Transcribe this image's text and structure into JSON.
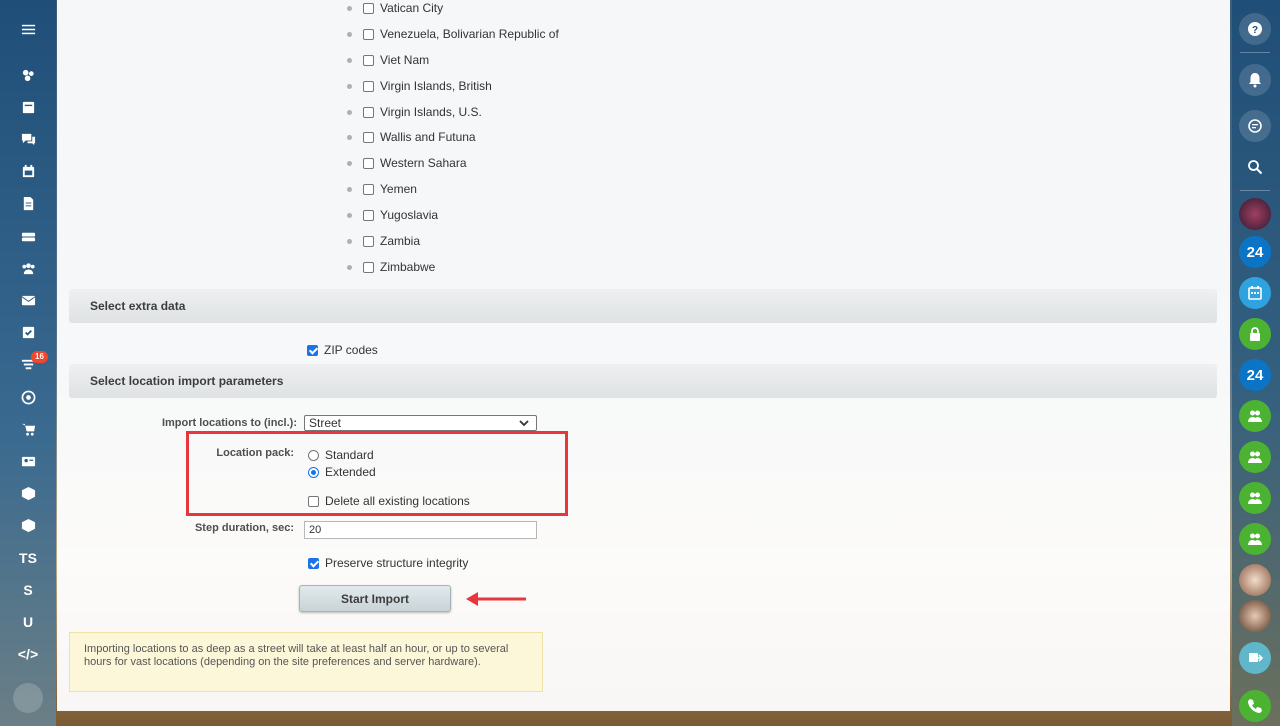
{
  "countries": [
    "Vatican City",
    "Venezuela, Bolivarian Republic of",
    "Viet Nam",
    "Virgin Islands, British",
    "Virgin Islands, U.S.",
    "Wallis and Futuna",
    "Western Sahara",
    "Yemen",
    "Yugoslavia",
    "Zambia",
    "Zimbabwe"
  ],
  "extra_section": {
    "title": "Select extra data",
    "zip_label": "ZIP codes",
    "zip_checked": true
  },
  "params_section": {
    "title": "Select location import parameters",
    "import_to_label": "Import locations to (incl.):",
    "import_to_value": "Street",
    "pack_label": "Location pack:",
    "pack_options": [
      "Standard",
      "Extended"
    ],
    "pack_selected": "Extended",
    "delete_label": "Delete all existing locations",
    "delete_checked": false,
    "step_label": "Step duration, sec:",
    "step_value": "20",
    "preserve_label": "Preserve structure integrity",
    "preserve_checked": true,
    "start_button": "Start Import"
  },
  "note": "Importing locations to as deep as a street will take at least half an hour, or up to several hours for vast locations (depending on the site preferences and server hardware).",
  "left_sidebar": {
    "badge_count": "16",
    "text_items": [
      "TS",
      "S",
      "U",
      "</>"
    ],
    "icons": [
      "menu-icon",
      "workgroups-icon",
      "feed-icon",
      "chat-icon",
      "calendar-icon",
      "document-icon",
      "drive-icon",
      "contacts-icon",
      "mail-icon",
      "tasks-icon",
      "filter-icon",
      "target-icon",
      "cart-icon",
      "contact-card-icon",
      "box-icon",
      "cube-icon"
    ]
  },
  "right_sidebar": {
    "tiles": [
      "24",
      "24"
    ],
    "icons": [
      "help-icon",
      "bell-icon",
      "chat-search-icon",
      "search-icon",
      "avatar",
      "bitrix24-icon",
      "calendar-icon",
      "lock-icon",
      "bitrix24-icon",
      "group-icon",
      "group-icon",
      "group-icon",
      "group-icon",
      "avatar-group",
      "avatar",
      "share-icon",
      "phone-icon"
    ]
  },
  "colors": {
    "accent": "#1a73e8",
    "highlight": "#e8363d",
    "badge": "#f0472e"
  }
}
